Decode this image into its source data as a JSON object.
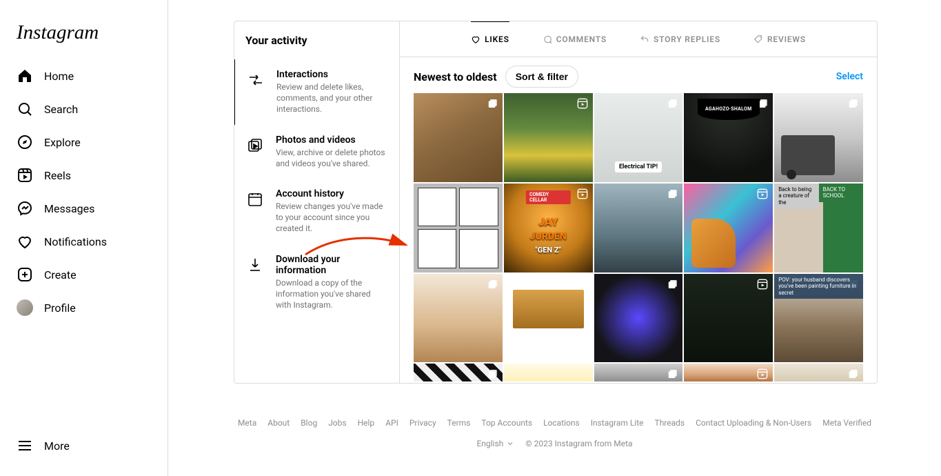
{
  "brand": "Instagram",
  "sidebar": {
    "items": [
      {
        "label": "Home",
        "icon": "home"
      },
      {
        "label": "Search",
        "icon": "search"
      },
      {
        "label": "Explore",
        "icon": "compass"
      },
      {
        "label": "Reels",
        "icon": "reels"
      },
      {
        "label": "Messages",
        "icon": "messenger"
      },
      {
        "label": "Notifications",
        "icon": "heart"
      },
      {
        "label": "Create",
        "icon": "plus"
      },
      {
        "label": "Profile",
        "icon": "avatar"
      }
    ],
    "more_label": "More"
  },
  "activity": {
    "header": "Your activity",
    "items": [
      {
        "title": "Interactions",
        "desc": "Review and delete likes, comments, and your other interactions.",
        "active": true
      },
      {
        "title": "Photos and videos",
        "desc": "View, archive or delete photos and videos you've shared."
      },
      {
        "title": "Account history",
        "desc": "Review changes you've made to your account since you created it."
      },
      {
        "title": "Download your information",
        "desc": "Download a copy of the information you've shared with Instagram."
      }
    ]
  },
  "tabs": [
    {
      "label": "LIKES",
      "icon": "heart",
      "active": true
    },
    {
      "label": "COMMENTS",
      "icon": "comment"
    },
    {
      "label": "STORY REPLIES",
      "icon": "reply"
    },
    {
      "label": "REVIEWS",
      "icon": "tag"
    }
  ],
  "toolbar": {
    "sort_label": "Newest to oldest",
    "filter_label": "Sort & filter",
    "select_label": "Select"
  },
  "tiles": [
    {
      "type": "carousel"
    },
    {
      "type": "reel"
    },
    {
      "type": "carousel",
      "label": "Electrical TIP!"
    },
    {
      "type": "carousel",
      "sign": "AGAHOZO·SHALOM"
    },
    {
      "type": "carousel"
    },
    {
      "type": "none",
      "comic": true
    },
    {
      "type": "reel",
      "jay": {
        "l1": "JAY",
        "l2": "JURDEN",
        "l3": "\"GEN Z\"",
        "badge": "COMEDY CELLAR"
      }
    },
    {
      "type": "carousel"
    },
    {
      "type": "reel"
    },
    {
      "type": "none",
      "split_caption_top": "Back to being a creature of the",
      "split_caption_top2": "BACK TO SCHOOL"
    },
    {
      "type": "carousel"
    },
    {
      "type": "none",
      "lions": true
    },
    {
      "type": "carousel"
    },
    {
      "type": "reel"
    },
    {
      "type": "carousel",
      "caption_top": "POV: your husband discovers you've been painting furniture in secret"
    },
    {
      "type": "carousel"
    },
    {
      "type": "none"
    },
    {
      "type": "carousel"
    },
    {
      "type": "reel"
    },
    {
      "type": "carousel"
    }
  ],
  "footer": {
    "links": [
      "Meta",
      "About",
      "Blog",
      "Jobs",
      "Help",
      "API",
      "Privacy",
      "Terms",
      "Top Accounts",
      "Locations",
      "Instagram Lite",
      "Threads",
      "Contact Uploading & Non-Users",
      "Meta Verified"
    ],
    "language": "English",
    "copyright": "© 2023 Instagram from Meta"
  },
  "colors": {
    "link": "#0095f6",
    "arrow": "#e53000"
  }
}
